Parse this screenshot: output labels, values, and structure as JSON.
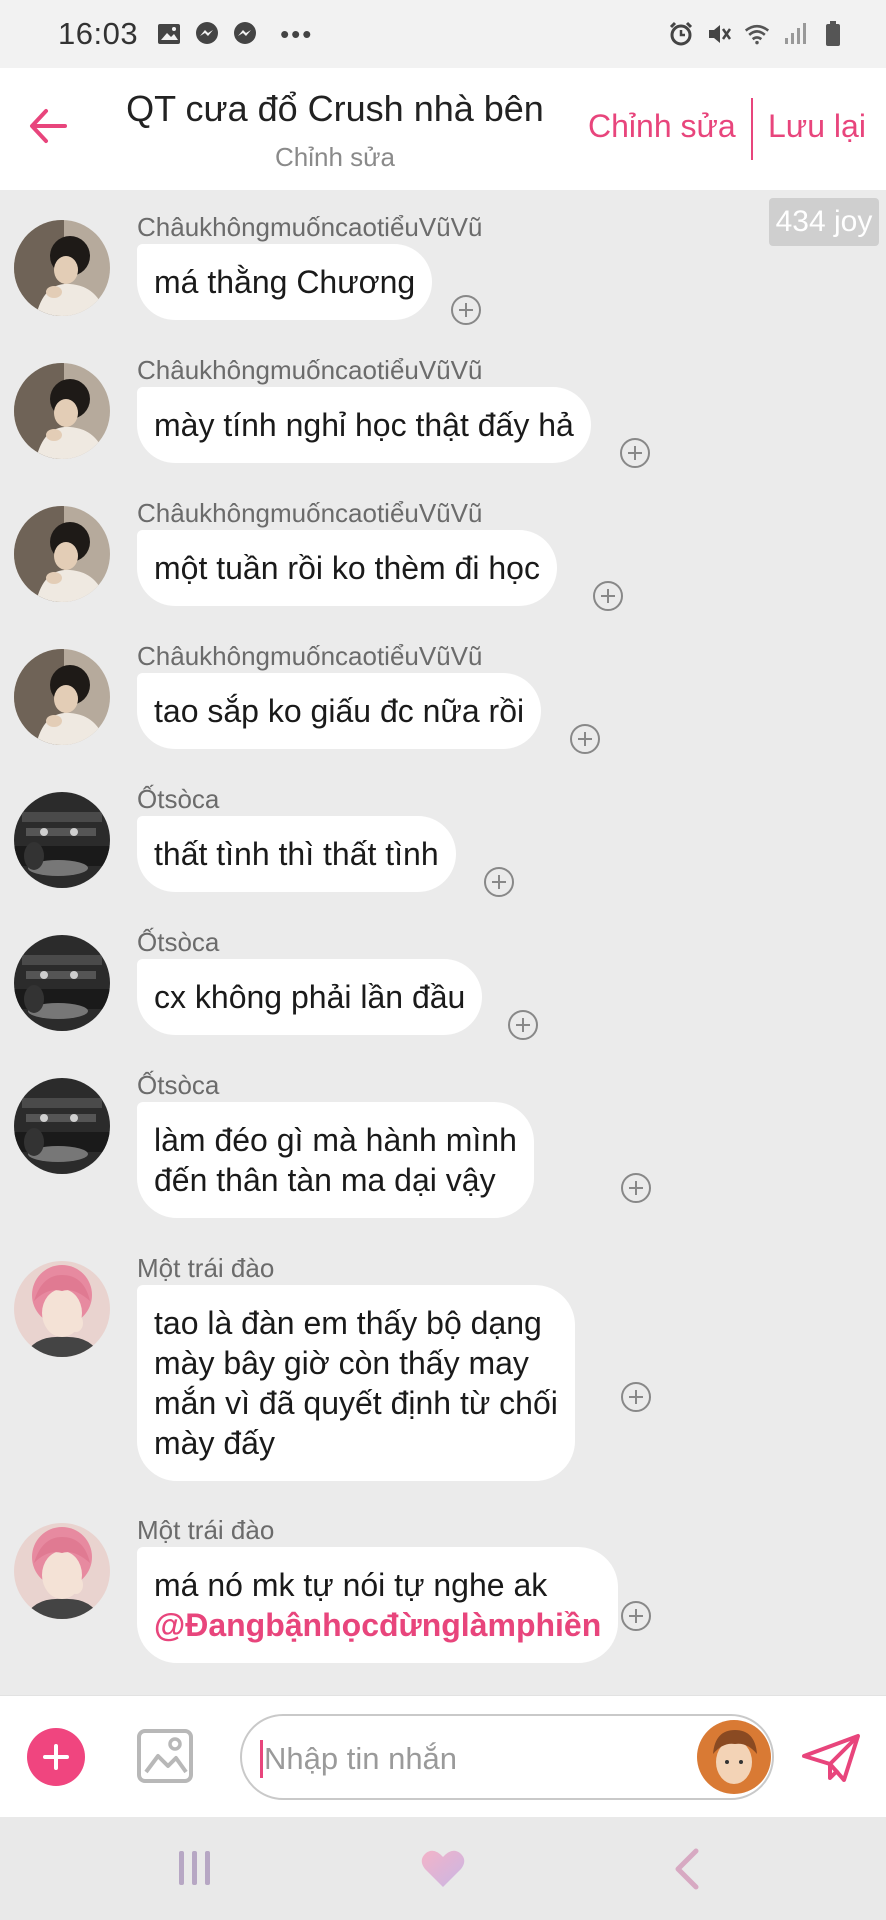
{
  "status_bar": {
    "time": "16:03",
    "left_icons": [
      "gallery-icon",
      "messenger-icon",
      "messenger-icon",
      "more-dots-icon"
    ],
    "more": "•••",
    "right_icons": [
      "alarm-icon",
      "mute-icon",
      "wifi-icon",
      "signal-icon",
      "battery-icon"
    ]
  },
  "header": {
    "title": "QT cưa đổ Crush nhà bên",
    "subtitle": "Chỉnh sửa",
    "edit_label": "Chỉnh sửa",
    "save_label": "Lưu lại",
    "accent": "#e8457c"
  },
  "chat": {
    "joy_badge": "434 joy",
    "messages": [
      {
        "sender": "ChâukhôngmuốncaotiểuVũVũ",
        "lines": [
          "má thằng Chương"
        ],
        "avatar": "dark-hair-avatar"
      },
      {
        "sender": "ChâukhôngmuốncaotiểuVũVũ",
        "lines": [
          "mày tính nghỉ học thật đấy hả"
        ],
        "avatar": "dark-hair-avatar"
      },
      {
        "sender": "ChâukhôngmuốncaotiểuVũVũ",
        "lines": [
          "một tuần rồi ko thèm đi học"
        ],
        "avatar": "dark-hair-avatar"
      },
      {
        "sender": "ChâukhôngmuốncaotiểuVũVũ",
        "lines": [
          "tao sắp ko giấu đc nữa rồi"
        ],
        "avatar": "dark-hair-avatar"
      },
      {
        "sender": "Ốtsòca",
        "lines": [
          "thất tình thì thất tình"
        ],
        "avatar": "studio-avatar"
      },
      {
        "sender": "Ốtsòca",
        "lines": [
          "cx không phải lần đầu"
        ],
        "avatar": "studio-avatar"
      },
      {
        "sender": "Ốtsòca",
        "lines": [
          "làm đéo gì mà hành mình",
          "đến thân tàn ma dại vậy"
        ],
        "avatar": "studio-avatar"
      },
      {
        "sender": "Một trái đào",
        "lines": [
          "tao là đàn em thấy bộ dạng",
          "mày bây giờ còn thấy may",
          "mắn vì đã quyết định từ chối",
          "mày đấy"
        ],
        "avatar": "pink-hair-avatar"
      },
      {
        "sender": "Một trái đào",
        "lines": [
          "má nó mk tự nói tự nghe ak"
        ],
        "mention": "@Đangbậnhọcđừnglàmphiền",
        "avatar": "pink-hair-avatar"
      }
    ]
  },
  "composer": {
    "placeholder": "Nhập tin nhắn",
    "plus_color": "#f0457f"
  },
  "navbar": {
    "icons": [
      "recent-apps-icon",
      "home-heart-icon",
      "back-icon"
    ]
  }
}
